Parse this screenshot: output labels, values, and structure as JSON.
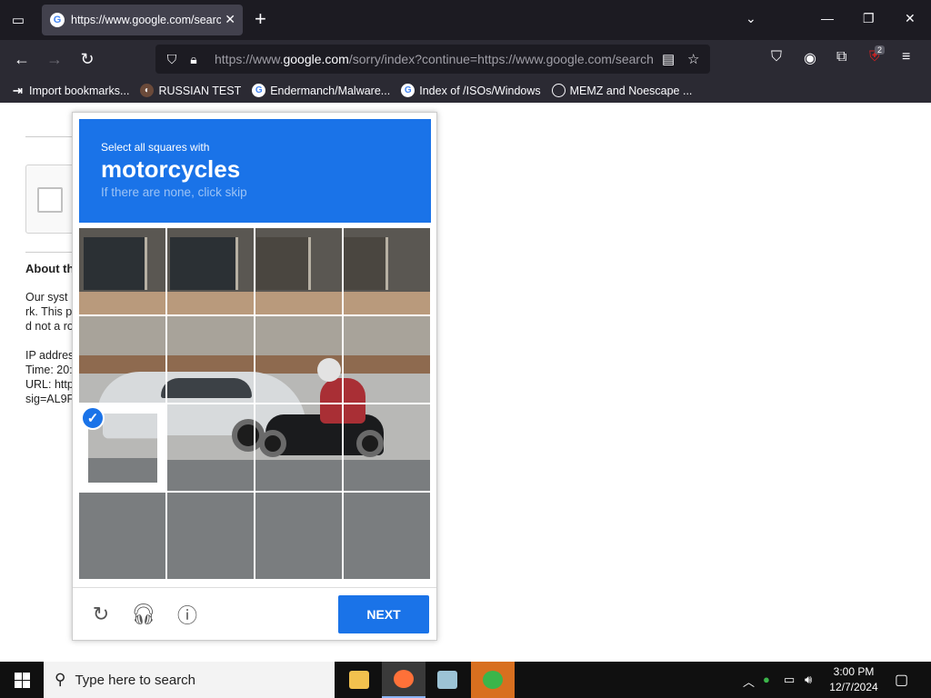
{
  "browser": {
    "tab": {
      "title": "https://www.google.com/searc"
    },
    "url": {
      "prefix": "https://www.",
      "domain": "google.com",
      "rest": "/sorry/index?continue=https://www.google.com/search"
    },
    "bookmarks": [
      {
        "label": "Import bookmarks...",
        "icon": "import-icon"
      },
      {
        "label": "RUSSIAN TEST",
        "icon": "bookmark-favicon"
      },
      {
        "label": "Endermanch/Malware...",
        "icon": "google-favicon"
      },
      {
        "label": "Index of /ISOs/Windows",
        "icon": "google-favicon"
      },
      {
        "label": "MEMZ and Noescape ...",
        "icon": "globe-icon"
      }
    ],
    "extension_badge": "2"
  },
  "page": {
    "about_title": "About th",
    "lines": [
      "Our syst",
      "rk. This p",
      "d not a ro",
      "IP addres",
      "Time: 20:",
      "URL: http",
      "sig=AL9F"
    ]
  },
  "captcha": {
    "instruction": "Select all squares with",
    "object": "motorcycles",
    "subtitle": "If there are none, click skip",
    "selected_tiles": [
      8
    ],
    "next_label": "NEXT",
    "colors": {
      "header": "#1a73e8",
      "button": "#1a73e8"
    }
  },
  "taskbar": {
    "search_placeholder": "Type here to search",
    "time": "3:00 PM",
    "date": "12/7/2024"
  }
}
